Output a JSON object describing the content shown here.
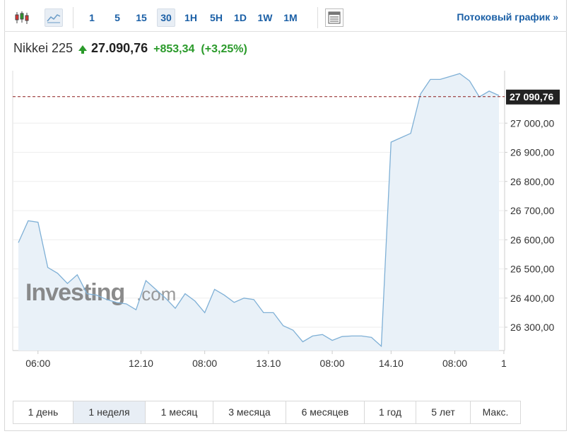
{
  "toolbar": {
    "candle_icon": "candlestick-icon",
    "line_icon": "line-chart-icon",
    "table_icon": "table-icon",
    "intervals": [
      "1",
      "5",
      "15",
      "30",
      "1H",
      "5H",
      "1D",
      "1W",
      "1M"
    ],
    "active_interval": "30",
    "stream_label": "Потоковый график",
    "stream_arrow": "»"
  },
  "ticker": {
    "name": "Nikkei 225",
    "price": "27.090,76",
    "change": "+853,34",
    "change_pct": "(+3,25%)",
    "up_color": "#2a9a2a"
  },
  "ranges": {
    "items": [
      "1 день",
      "1 неделя",
      "1 месяц",
      "3 месяца",
      "6 месяцев",
      "1 год",
      "5 лет",
      "Макс."
    ],
    "active": "1 неделя"
  },
  "watermark": {
    "brand": "Investing",
    "suffix": ".com"
  },
  "chart_data": {
    "type": "area",
    "line_color": "#7fb0d6",
    "fill_color": "#e9f1f8",
    "last_price_label": "27 090,76",
    "last_price": 27090.76,
    "y_ticks": [
      {
        "value": 26300,
        "label": "26 300,00"
      },
      {
        "value": 26400,
        "label": "26 400,00"
      },
      {
        "value": 26500,
        "label": "26 500,00"
      },
      {
        "value": 26600,
        "label": "26 600,00"
      },
      {
        "value": 26700,
        "label": "26 700,00"
      },
      {
        "value": 26800,
        "label": "26 800,00"
      },
      {
        "value": 26900,
        "label": "26 900,00"
      },
      {
        "value": 27000,
        "label": "27 000,00"
      }
    ],
    "ylim": [
      26220,
      27180
    ],
    "x_ticks": [
      {
        "label": "06:00",
        "i": 2
      },
      {
        "label": "12.10",
        "i": 12.5
      },
      {
        "label": "08:00",
        "i": 19
      },
      {
        "label": "13.10",
        "i": 25.5
      },
      {
        "label": "08:00",
        "i": 32
      },
      {
        "label": "14.10",
        "i": 38
      },
      {
        "label": "08:00",
        "i": 44.5
      },
      {
        "label": "1",
        "i": 49.5
      }
    ],
    "values": [
      26590,
      26665,
      26660,
      26505,
      26485,
      26450,
      26480,
      26415,
      26410,
      26395,
      26385,
      26380,
      26360,
      26460,
      26430,
      26400,
      26365,
      26415,
      26390,
      26350,
      26430,
      26410,
      26385,
      26400,
      26395,
      26350,
      26350,
      26305,
      26290,
      26250,
      26270,
      26275,
      26255,
      26268,
      26270,
      26270,
      26265,
      26235,
      26935,
      26950,
      26965,
      27100,
      27150,
      27150,
      27160,
      27170,
      27145,
      27090,
      27110,
      27095
    ]
  }
}
